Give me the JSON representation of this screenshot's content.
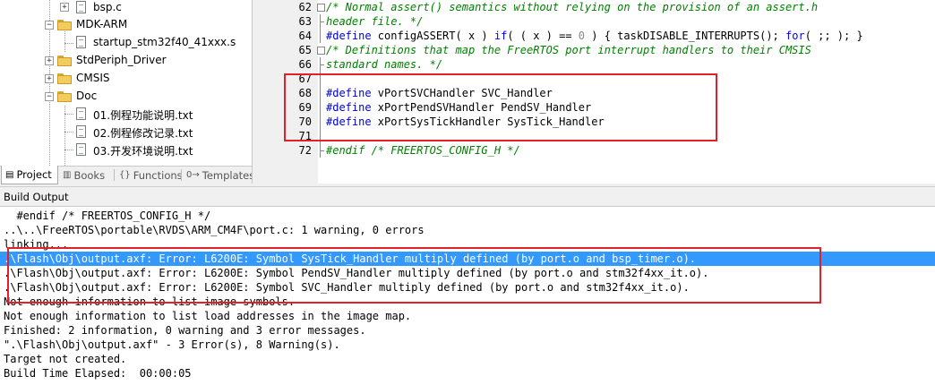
{
  "project_tree": {
    "items": [
      {
        "label": "bsp.c",
        "type": "file"
      },
      {
        "label": "MDK-ARM",
        "type": "folder"
      },
      {
        "label": "startup_stm32f40_41xxx.s",
        "type": "file"
      },
      {
        "label": "StdPeriph_Driver",
        "type": "folder"
      },
      {
        "label": "CMSIS",
        "type": "folder"
      },
      {
        "label": "Doc",
        "type": "folder"
      },
      {
        "label": "01.例程功能说明.txt",
        "type": "file"
      },
      {
        "label": "02.例程修改记录.txt",
        "type": "file"
      },
      {
        "label": "03.开发环境说明.txt",
        "type": "file"
      }
    ]
  },
  "panel_tabs": [
    {
      "label": "Project",
      "icon": "project-icon"
    },
    {
      "label": "Books",
      "icon": "books-icon"
    },
    {
      "label": "Functions",
      "icon": "{}"
    },
    {
      "label": "Templates",
      "icon": "0→"
    }
  ],
  "editor": {
    "lines": [
      {
        "num": "62",
        "parts": [
          {
            "c": "cmt",
            "t": "/* Normal assert() semantics without relying on the provision of an assert.h"
          }
        ]
      },
      {
        "num": "63",
        "parts": [
          {
            "c": "cmt",
            "t": "header file. */"
          }
        ]
      },
      {
        "num": "64",
        "parts": [
          {
            "c": "pp",
            "t": "#define"
          },
          {
            "c": "",
            "t": " configASSERT( x ) "
          },
          {
            "c": "kw",
            "t": "if"
          },
          {
            "c": "",
            "t": "( ( x ) == "
          },
          {
            "c": "num",
            "t": "0"
          },
          {
            "c": "",
            "t": " ) { taskDISABLE_INTERRUPTS(); "
          },
          {
            "c": "kw",
            "t": "for"
          },
          {
            "c": "",
            "t": "( ;; ); }"
          }
        ]
      },
      {
        "num": "65",
        "parts": [
          {
            "c": "cmt",
            "t": "/* Definitions that map the FreeRTOS port interrupt handlers to their CMSIS"
          }
        ]
      },
      {
        "num": "66",
        "parts": [
          {
            "c": "cmt",
            "t": "standard names. */"
          }
        ]
      },
      {
        "num": "67",
        "parts": []
      },
      {
        "num": "68",
        "parts": [
          {
            "c": "pp",
            "t": "#define"
          },
          {
            "c": "",
            "t": " vPortSVCHandler SVC_Handler"
          }
        ]
      },
      {
        "num": "69",
        "parts": [
          {
            "c": "pp",
            "t": "#define"
          },
          {
            "c": "",
            "t": " xPortPendSVHandler PendSV_Handler"
          }
        ]
      },
      {
        "num": "70",
        "parts": [
          {
            "c": "pp",
            "t": "#define"
          },
          {
            "c": "",
            "t": " xPortSysTickHandler SysTick_Handler"
          }
        ]
      },
      {
        "num": "71",
        "parts": []
      },
      {
        "num": "72",
        "parts": [
          {
            "c": "cmt",
            "t": "#endif /* FREERTOS_CONFIG_H */"
          }
        ]
      }
    ]
  },
  "build_output": {
    "title": "Build Output",
    "lines": [
      "  #endif /* FREERTOS_CONFIG_H */",
      "..\\..\\FreeRTOS\\portable\\RVDS\\ARM_CM4F\\port.c: 1 warning, 0 errors",
      "linking...",
      ".\\Flash\\Obj\\output.axf: Error: L6200E: Symbol SysTick_Handler multiply defined (by port.o and bsp_timer.o).",
      ".\\Flash\\Obj\\output.axf: Error: L6200E: Symbol PendSV_Handler multiply defined (by port.o and stm32f4xx_it.o).",
      ".\\Flash\\Obj\\output.axf: Error: L6200E: Symbol SVC_Handler multiply defined (by port.o and stm32f4xx_it.o).",
      "Not enough information to list image symbols.",
      "Not enough information to list load addresses in the image map.",
      "Finished: 2 information, 0 warning and 3 error messages.",
      "\".\\Flash\\Obj\\output.axf\" - 3 Error(s), 8 Warning(s).",
      "Target not created.",
      "Build Time Elapsed:  00:00:05"
    ],
    "selected_index": 3
  },
  "colors": {
    "annotation_red": "#e0212b",
    "selection_blue": "#3399ff",
    "comment_green": "#008000",
    "keyword_blue": "#0000ff"
  }
}
